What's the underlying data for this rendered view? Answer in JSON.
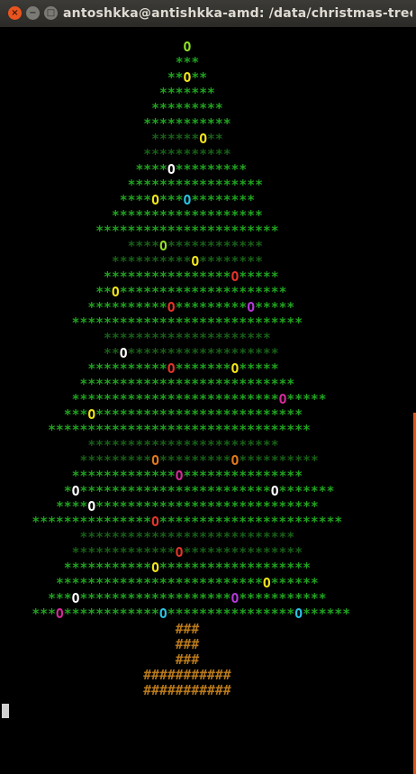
{
  "window": {
    "title": "antoshkka@antishkka-amd: /data/christmas-tree",
    "buttons": {
      "close": "×",
      "minimize": "−",
      "maximize": "□"
    }
  },
  "colors": {
    "background": "#000000",
    "needles": "#1fa21f",
    "needles_dim": "#175f17",
    "trunk": "#b8791b",
    "orn_yellow": "#f0e31a",
    "orn_white": "#ffffff",
    "orn_cyan": "#2ac3e3",
    "orn_red": "#e5342a",
    "orn_purple": "#b43ad6",
    "orn_magenta": "#d62b9a",
    "orn_orange": "#e0781d",
    "orn_lime": "#8fe028",
    "scrollbar": "#e1561a"
  },
  "terminal": {
    "cursor": "▌",
    "lines": [
      {
        "pad": 23,
        "segs": [
          [
            "o",
            "O",
            "orn_lime"
          ]
        ]
      },
      {
        "pad": 22,
        "segs": [
          [
            "g",
            "***"
          ]
        ]
      },
      {
        "pad": 21,
        "segs": [
          [
            "g",
            "**"
          ],
          [
            "o",
            "O",
            "orn_yellow"
          ],
          [
            "g",
            "**"
          ]
        ]
      },
      {
        "pad": 20,
        "segs": [
          [
            "g",
            "*******"
          ]
        ]
      },
      {
        "pad": 19,
        "segs": [
          [
            "g",
            "*********"
          ]
        ]
      },
      {
        "pad": 18,
        "segs": [
          [
            "g",
            "***********"
          ]
        ]
      },
      {
        "pad": 19,
        "segs": [
          [
            "d",
            "******"
          ],
          [
            "o",
            "O",
            "orn_yellow"
          ],
          [
            "d",
            "**"
          ]
        ]
      },
      {
        "pad": 18,
        "segs": [
          [
            "d",
            "***********"
          ]
        ]
      },
      {
        "pad": 17,
        "segs": [
          [
            "g",
            "****"
          ],
          [
            "o",
            "O",
            "orn_white"
          ],
          [
            "g",
            "*********"
          ]
        ]
      },
      {
        "pad": 16,
        "segs": [
          [
            "g",
            "*****************"
          ]
        ]
      },
      {
        "pad": 15,
        "segs": [
          [
            "g",
            "****"
          ],
          [
            "o",
            "O",
            "orn_yellow"
          ],
          [
            "g",
            "***"
          ],
          [
            "o",
            "O",
            "orn_cyan"
          ],
          [
            "g",
            "********"
          ]
        ]
      },
      {
        "pad": 14,
        "segs": [
          [
            "g",
            "*******************"
          ]
        ]
      },
      {
        "pad": 12,
        "segs": [
          [
            "g",
            "***********************"
          ]
        ]
      },
      {
        "pad": 16,
        "segs": [
          [
            "d",
            "****"
          ],
          [
            "o",
            "O",
            "orn_lime"
          ],
          [
            "d",
            "************"
          ]
        ]
      },
      {
        "pad": 14,
        "segs": [
          [
            "d",
            "**********"
          ],
          [
            "o",
            "O",
            "orn_yellow"
          ],
          [
            "d",
            "********"
          ]
        ]
      },
      {
        "pad": 13,
        "segs": [
          [
            "g",
            "****************"
          ],
          [
            "o",
            "O",
            "orn_red"
          ],
          [
            "g",
            "*****"
          ]
        ]
      },
      {
        "pad": 12,
        "segs": [
          [
            "g",
            "**"
          ],
          [
            "o",
            "O",
            "orn_yellow"
          ],
          [
            "g",
            "*********************"
          ]
        ]
      },
      {
        "pad": 11,
        "segs": [
          [
            "g",
            "**********"
          ],
          [
            "o",
            "O",
            "orn_red"
          ],
          [
            "g",
            "*********"
          ],
          [
            "o",
            "O",
            "orn_purple"
          ],
          [
            "g",
            "*****"
          ]
        ]
      },
      {
        "pad": 9,
        "segs": [
          [
            "g",
            "*****************************"
          ]
        ]
      },
      {
        "pad": 13,
        "segs": [
          [
            "d",
            "*********************"
          ]
        ]
      },
      {
        "pad": 13,
        "segs": [
          [
            "d",
            "**"
          ],
          [
            "o",
            "O",
            "orn_white"
          ],
          [
            "d",
            "*******************"
          ]
        ]
      },
      {
        "pad": 11,
        "segs": [
          [
            "g",
            "**********"
          ],
          [
            "o",
            "O",
            "orn_red"
          ],
          [
            "g",
            "*******"
          ],
          [
            "o",
            "O",
            "orn_yellow"
          ],
          [
            "g",
            "*****"
          ]
        ]
      },
      {
        "pad": 10,
        "segs": [
          [
            "g",
            "***************************"
          ]
        ]
      },
      {
        "pad": 9,
        "segs": [
          [
            "g",
            "**************************"
          ],
          [
            "o",
            "O",
            "orn_magenta"
          ],
          [
            "g",
            "*****"
          ]
        ]
      },
      {
        "pad": 8,
        "segs": [
          [
            "g",
            "***"
          ],
          [
            "o",
            "O",
            "orn_yellow"
          ],
          [
            "g",
            "**************************"
          ]
        ]
      },
      {
        "pad": 6,
        "segs": [
          [
            "g",
            "*********************************"
          ]
        ]
      },
      {
        "pad": 11,
        "segs": [
          [
            "d",
            "************************"
          ]
        ]
      },
      {
        "pad": 10,
        "segs": [
          [
            "d",
            "*********"
          ],
          [
            "o",
            "O",
            "orn_orange"
          ],
          [
            "d",
            "*********"
          ],
          [
            "o",
            "O",
            "orn_orange"
          ],
          [
            "d",
            "**********"
          ]
        ]
      },
      {
        "pad": 9,
        "segs": [
          [
            "g",
            "*************"
          ],
          [
            "o",
            "O",
            "orn_magenta"
          ],
          [
            "g",
            "***************"
          ]
        ]
      },
      {
        "pad": 8,
        "segs": [
          [
            "g",
            "*"
          ],
          [
            "o",
            "O",
            "orn_white"
          ],
          [
            "g",
            "************************"
          ],
          [
            "o",
            "O",
            "orn_white"
          ],
          [
            "g",
            "*******"
          ]
        ]
      },
      {
        "pad": 7,
        "segs": [
          [
            "g",
            "****"
          ],
          [
            "o",
            "O",
            "orn_white"
          ],
          [
            "g",
            "****************************"
          ]
        ]
      },
      {
        "pad": 4,
        "segs": [
          [
            "g",
            "***************"
          ],
          [
            "o",
            "O",
            "orn_red"
          ],
          [
            "g",
            "***********************"
          ]
        ]
      },
      {
        "pad": 10,
        "segs": [
          [
            "d",
            "***************************"
          ]
        ]
      },
      {
        "pad": 9,
        "segs": [
          [
            "d",
            "*************"
          ],
          [
            "o",
            "O",
            "orn_red"
          ],
          [
            "d",
            "***************"
          ]
        ]
      },
      {
        "pad": 8,
        "segs": [
          [
            "g",
            "***********"
          ],
          [
            "o",
            "O",
            "orn_yellow"
          ],
          [
            "g",
            "*******************"
          ]
        ]
      },
      {
        "pad": 7,
        "segs": [
          [
            "g",
            "**************************"
          ],
          [
            "o",
            "O",
            "orn_yellow"
          ],
          [
            "g",
            "******"
          ]
        ]
      },
      {
        "pad": 6,
        "segs": [
          [
            "g",
            "***"
          ],
          [
            "o",
            "O",
            "orn_white"
          ],
          [
            "g",
            "*******************"
          ],
          [
            "o",
            "O",
            "orn_purple"
          ],
          [
            "g",
            "***********"
          ]
        ]
      },
      {
        "pad": 4,
        "segs": [
          [
            "g",
            "***"
          ],
          [
            "o",
            "O",
            "orn_magenta"
          ],
          [
            "g",
            "************"
          ],
          [
            "o",
            "O",
            "orn_cyan"
          ],
          [
            "g",
            "****************"
          ],
          [
            "o",
            "O",
            "orn_cyan"
          ],
          [
            "g",
            "******"
          ]
        ]
      },
      {
        "pad": 22,
        "segs": [
          [
            "t",
            "###"
          ]
        ]
      },
      {
        "pad": 22,
        "segs": [
          [
            "t",
            "###"
          ]
        ]
      },
      {
        "pad": 22,
        "segs": [
          [
            "t",
            "###"
          ]
        ]
      },
      {
        "pad": 18,
        "segs": [
          [
            "t",
            "###########"
          ]
        ]
      },
      {
        "pad": 18,
        "segs": [
          [
            "t",
            "###########"
          ]
        ]
      }
    ]
  }
}
